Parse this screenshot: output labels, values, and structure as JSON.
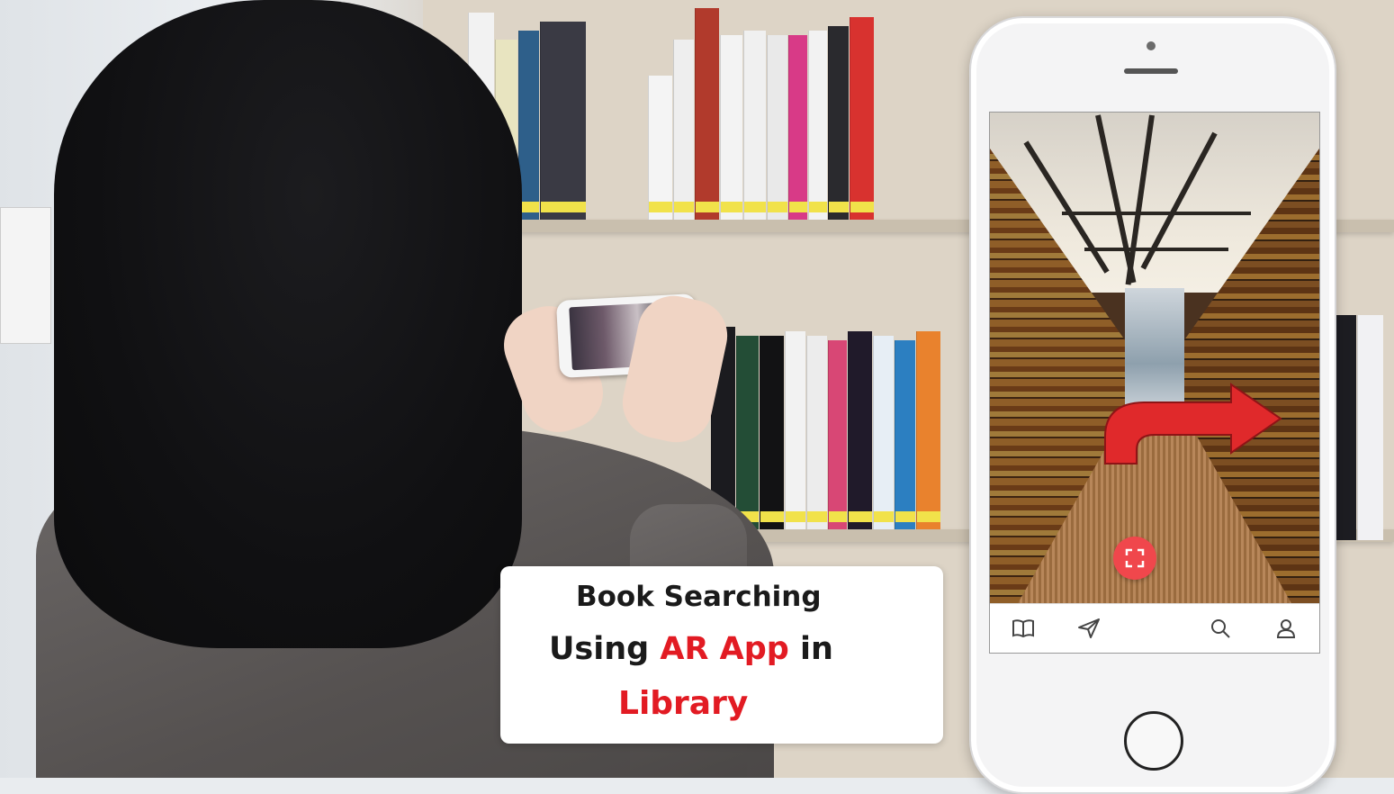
{
  "caption": {
    "line1": "Book Searching",
    "line2_pre": "Using ",
    "line2_highlight": "AR App",
    "line2_post": " in",
    "line3": "Library"
  },
  "colors": {
    "highlight_red": "#e21b23",
    "scan_button": "#f0474c",
    "arrow_red": "#e0292b"
  },
  "phone_app": {
    "nav_icons": [
      "book-icon",
      "send-icon",
      "scan-icon",
      "search-icon",
      "profile-icon"
    ]
  }
}
